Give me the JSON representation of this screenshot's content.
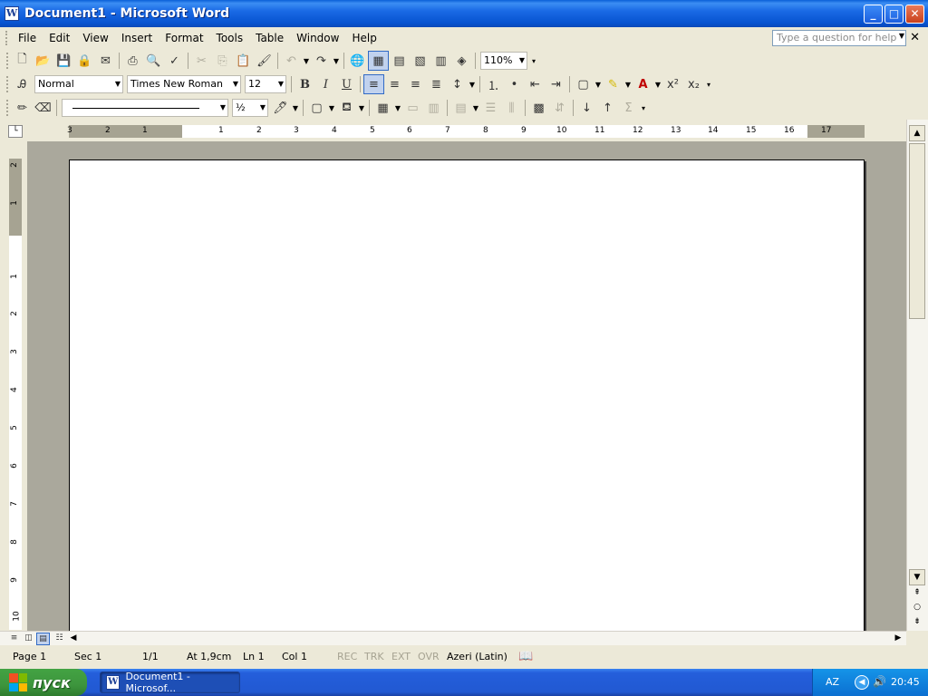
{
  "window": {
    "title": "Document1 - Microsoft Word",
    "app_icon": "W"
  },
  "menu": {
    "items": [
      "File",
      "Edit",
      "View",
      "Insert",
      "Format",
      "Tools",
      "Table",
      "Window",
      "Help"
    ],
    "help_placeholder": "Type a question for help"
  },
  "formatting": {
    "style": "Normal",
    "font": "Times New Roman",
    "size": "12",
    "zoom": "110%",
    "line_weight": "½"
  },
  "ruler": {
    "h_numbers": [
      "3",
      "2",
      "1",
      "1",
      "2",
      "3",
      "4",
      "5",
      "6",
      "7",
      "8",
      "9",
      "10",
      "11",
      "12",
      "13",
      "14",
      "15",
      "16",
      "17"
    ],
    "v_numbers": [
      "2",
      "1",
      "1",
      "2",
      "3",
      "4",
      "5",
      "6",
      "7",
      "8",
      "9",
      "10"
    ]
  },
  "status": {
    "page": "Page  1",
    "sec": "Sec  1",
    "pages": "1/1",
    "at": "At  1,9cm",
    "ln": "Ln  1",
    "col": "Col  1",
    "rec": "REC",
    "trk": "TRK",
    "ext": "EXT",
    "ovr": "OVR",
    "language": "Azeri (Latin)"
  },
  "taskbar": {
    "start_label": "пуск",
    "task_item": "Document1 - Microsof...",
    "lang": "AZ",
    "clock": "20:45"
  },
  "colors": {
    "titlebar": "#0a5fd8",
    "taskbar": "#245edb",
    "start": "#3d953d",
    "chrome": "#ece9d8"
  }
}
